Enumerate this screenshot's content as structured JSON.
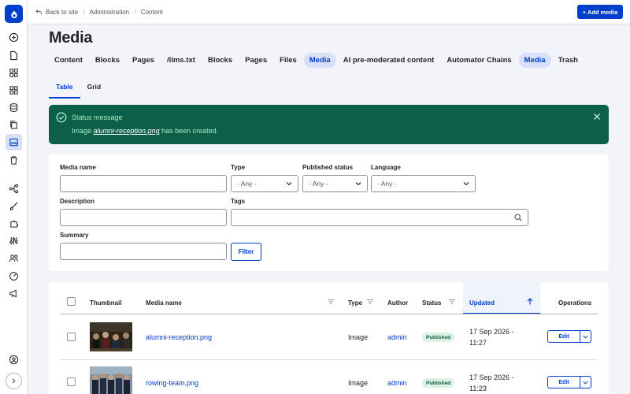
{
  "topbar": {
    "back_label": "Back to site",
    "breadcrumb": [
      "Administration",
      "Content"
    ],
    "add_button": "+ Add media"
  },
  "page": {
    "title": "Media"
  },
  "tabs": [
    {
      "label": "Content",
      "active": false
    },
    {
      "label": "Blocks",
      "active": false
    },
    {
      "label": "Pages",
      "active": false
    },
    {
      "label": "/llms.txt",
      "active": false
    },
    {
      "label": "Blocks",
      "active": false
    },
    {
      "label": "Pages",
      "active": false
    },
    {
      "label": "Files",
      "active": false
    },
    {
      "label": "Media",
      "active": true
    },
    {
      "label": "AI pre-moderated content",
      "active": false
    },
    {
      "label": "Automator Chains",
      "active": false
    },
    {
      "label": "Media",
      "active": true
    },
    {
      "label": "Trash",
      "active": false
    }
  ],
  "subtabs": [
    {
      "label": "Table",
      "active": true
    },
    {
      "label": "Grid",
      "active": false
    }
  ],
  "status": {
    "title": "Status message",
    "prefix": "Image",
    "filename": "alumni-reception.png",
    "suffix": "has been created."
  },
  "filters": {
    "media_name_label": "Media name",
    "media_name_value": "",
    "type_label": "Type",
    "type_value": "- Any -",
    "published_label": "Published status",
    "published_value": "- Any -",
    "language_label": "Language",
    "language_value": "- Any -",
    "description_label": "Description",
    "description_value": "",
    "tags_label": "Tags",
    "tags_value": "",
    "summary_label": "Summary",
    "summary_value": "",
    "filter_button": "Filter"
  },
  "table": {
    "headers": {
      "thumbnail": "Thumbnail",
      "media_name": "Media name",
      "type": "Type",
      "author": "Author",
      "status": "Status",
      "updated": "Updated",
      "operations": "Operations"
    },
    "rows": [
      {
        "name": "alumni-reception.png",
        "type": "Image",
        "author": "admin",
        "status": "Published",
        "updated_date": "17 Sep 2026 -",
        "updated_time": "11:27",
        "edit": "Edit"
      },
      {
        "name": "rowing-team.png",
        "type": "Image",
        "author": "admin",
        "status": "Published",
        "updated_date": "17 Sep 2026 -",
        "updated_time": "11:23",
        "edit": "Edit"
      }
    ]
  },
  "colors": {
    "accent": "#003ecc",
    "status_bg": "#0c5f48",
    "badge_bg": "#dcf1e4"
  },
  "icons": [
    "drupal-logo-icon",
    "plus-circle-icon",
    "file-icon",
    "grid-icon",
    "grid-alt-icon",
    "database-icon",
    "copy-icon",
    "media-icon",
    "trash-icon",
    "structure-icon",
    "brush-icon",
    "puzzle-icon",
    "sliders-icon",
    "people-icon",
    "gauge-icon",
    "megaphone-icon",
    "user-icon",
    "expand-icon"
  ]
}
